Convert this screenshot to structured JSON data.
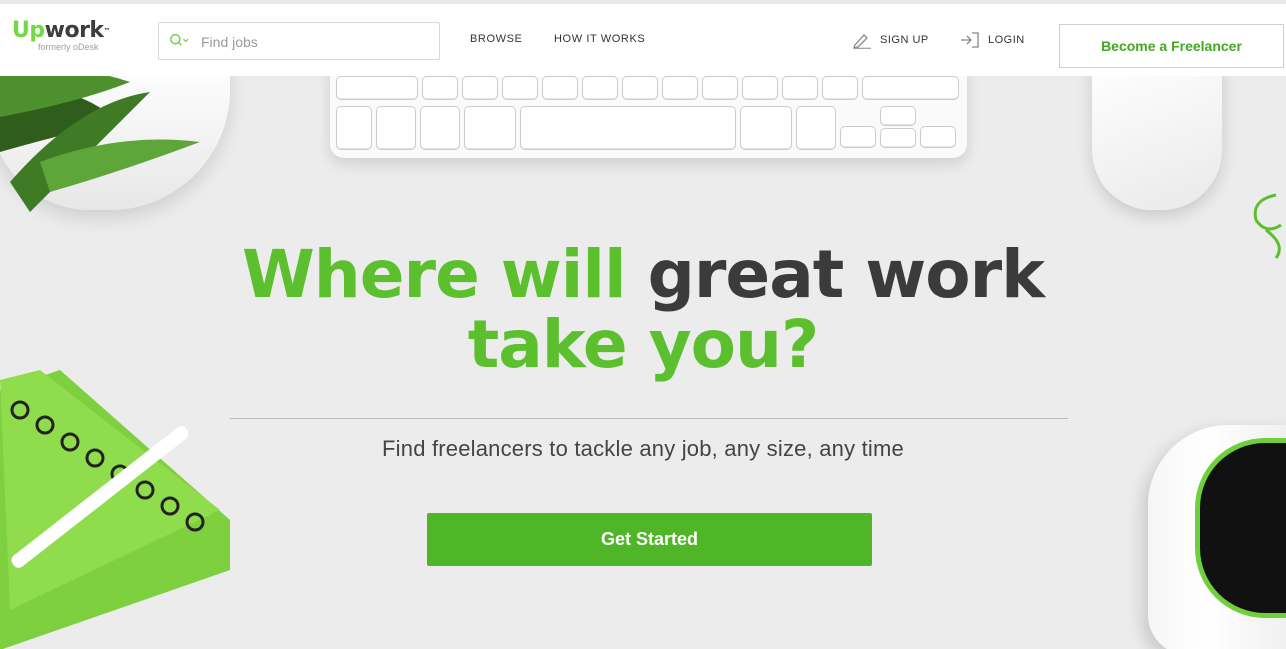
{
  "header": {
    "logo": {
      "part1": "Up",
      "part2": "work",
      "tm": "™",
      "tagline": "formerly oDesk"
    },
    "search": {
      "placeholder": "Find jobs"
    },
    "nav": [
      {
        "label": "BROWSE"
      },
      {
        "label": "HOW IT WORKS"
      }
    ],
    "signup_label": "SIGN UP",
    "login_label": "LOGIN",
    "freelancer_button": "Become a Freelancer"
  },
  "hero": {
    "title_green_1": "Where will",
    "title_dark_1": "great work",
    "title_green_2": "take you?",
    "subtitle": "Find freelancers to tackle any job, any size, any time",
    "cta_label": "Get Started"
  },
  "colors": {
    "brand_green": "#5cc02e",
    "button_green": "#4fb627",
    "dark_text": "#3b3b3b"
  },
  "icons": [
    "search-icon",
    "chevron-down-icon",
    "pencil-icon",
    "login-icon"
  ]
}
